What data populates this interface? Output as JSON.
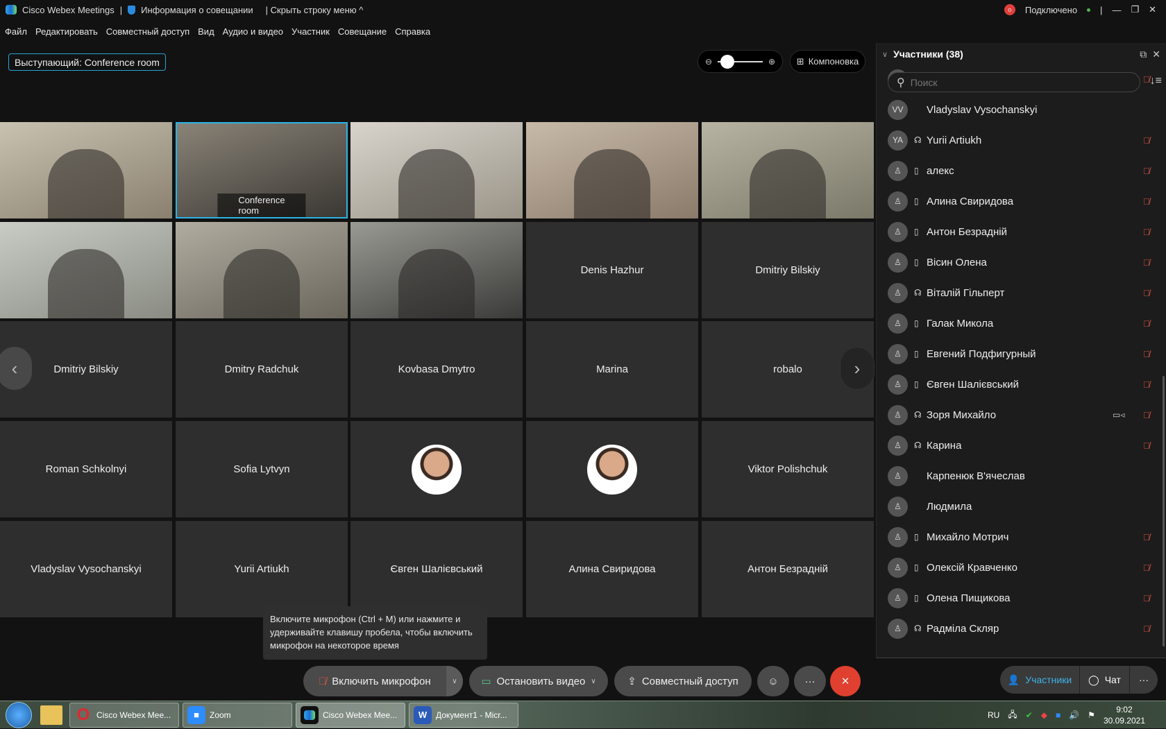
{
  "titlebar": {
    "app_title": "Cisco Webex Meetings",
    "sep": "|",
    "meeting_info": "Информация о совещании",
    "hide_menu": "| Скрыть строку меню ^",
    "status": "Подключено"
  },
  "menu": [
    "Файл",
    "Редактировать",
    "Совместный доступ",
    "Вид",
    "Аудио и видео",
    "Участник",
    "Совещание",
    "Справка"
  ],
  "presenter": "Выступающий: Conference room",
  "zoom": {
    "level": 0.1
  },
  "layout_label": "Компоновка",
  "tiles": [
    {
      "name": "",
      "video": true,
      "colors": [
        "#8a8070",
        "#c8c2b0"
      ]
    },
    {
      "name": "Conference room",
      "video": true,
      "active": true,
      "colors": [
        "#3a3632",
        "#8a8478"
      ]
    },
    {
      "name": "",
      "video": true,
      "colors": [
        "#9a9488",
        "#d8d4cc"
      ]
    },
    {
      "name": "",
      "video": true,
      "colors": [
        "#8a7a6a",
        "#c8baa8"
      ]
    },
    {
      "name": "",
      "video": true,
      "colors": [
        "#7a7868",
        "#b8b4a4"
      ]
    },
    {
      "name": "",
      "video": true,
      "colors": [
        "#8a8c84",
        "#c8ccc4"
      ]
    },
    {
      "name": "",
      "video": true,
      "colors": [
        "#6a665c",
        "#b0aca0"
      ]
    },
    {
      "name": "",
      "video": true,
      "colors": [
        "#3a3a38",
        "#9a9a94"
      ]
    },
    {
      "name": "Denis Hazhur"
    },
    {
      "name": "Dmitriy Bilskiy"
    },
    {
      "name": "Dmitriy Bilskiy"
    },
    {
      "name": "Dmitry Radchuk"
    },
    {
      "name": "Kovbasa Dmytro"
    },
    {
      "name": "Marina"
    },
    {
      "name": "robalo"
    },
    {
      "name": "Roman Schkolnyi"
    },
    {
      "name": "Sofia Lytvyn"
    },
    {
      "name": "",
      "photo": true
    },
    {
      "name": "",
      "photo": true
    },
    {
      "name": "Viktor Polishchuk"
    },
    {
      "name": "Vladyslav Vysochanskyi"
    },
    {
      "name": "Yurii Artiukh"
    },
    {
      "name": "Євген Шалієвський"
    },
    {
      "name": "Алина Свиридова"
    },
    {
      "name": "Антон Безрадній"
    }
  ],
  "participants": {
    "title": "Участники (38)",
    "search_placeholder": "Поиск",
    "items": [
      {
        "name": "Viktor Polishchuk",
        "avatar": "",
        "device": "",
        "muted": true
      },
      {
        "name": "Vladyslav Vysochanskyi",
        "avatar": "VV",
        "device": "",
        "muted": false
      },
      {
        "name": "Yurii Artiukh",
        "avatar": "YA",
        "device": "headset",
        "muted": true
      },
      {
        "name": "алекс",
        "device": "phone",
        "muted": true
      },
      {
        "name": "Алина Свиридова",
        "device": "phone",
        "muted": true
      },
      {
        "name": "Антон Безрадній",
        "device": "phone",
        "muted": true
      },
      {
        "name": "Вісин Олена",
        "device": "phone",
        "muted": true
      },
      {
        "name": "Віталій Гільперт",
        "device": "headset",
        "muted": true
      },
      {
        "name": "Галак Микола",
        "device": "phone",
        "muted": true
      },
      {
        "name": "Евгений Подфигурный",
        "device": "phone",
        "muted": true
      },
      {
        "name": "Євген Шалієвський",
        "device": "phone",
        "muted": true
      },
      {
        "name": "Зоря Михайло",
        "device": "headset",
        "video": true,
        "muted": true
      },
      {
        "name": "Карина",
        "device": "headset",
        "muted": true
      },
      {
        "name": "Карпенюк В'ячеслав",
        "device": "",
        "muted": false
      },
      {
        "name": "Людмила",
        "device": "",
        "muted": false
      },
      {
        "name": "Михайло Мотрич",
        "device": "phone",
        "muted": true
      },
      {
        "name": "Олексій Кравченко",
        "device": "phone",
        "muted": true
      },
      {
        "name": "Олена Пищикова",
        "device": "phone",
        "muted": true
      },
      {
        "name": "Радміла Скляр",
        "device": "headset",
        "muted": true
      }
    ]
  },
  "tooltip": "Включите микрофон (Ctrl + M) или нажмите и удерживайте клавишу пробела, чтобы включить микрофон на некоторое время",
  "controls": {
    "mic": "Включить микрофон",
    "video": "Остановить видео",
    "share": "Совместный доступ",
    "more": "···",
    "end": "✕"
  },
  "side_tabs": {
    "participants": "Участники",
    "chat": "Чат",
    "more": "···"
  },
  "taskbar": {
    "items": [
      "Cisco Webex Mee...",
      "Zoom",
      "Cisco Webex Mee...",
      "Документ1 - Micr..."
    ],
    "lang": "RU",
    "time": "9:02",
    "date": "30.09.2021"
  },
  "colors": {
    "accent": "#2ab4e6",
    "muted": "#d9553f",
    "end": "#e0402f"
  }
}
